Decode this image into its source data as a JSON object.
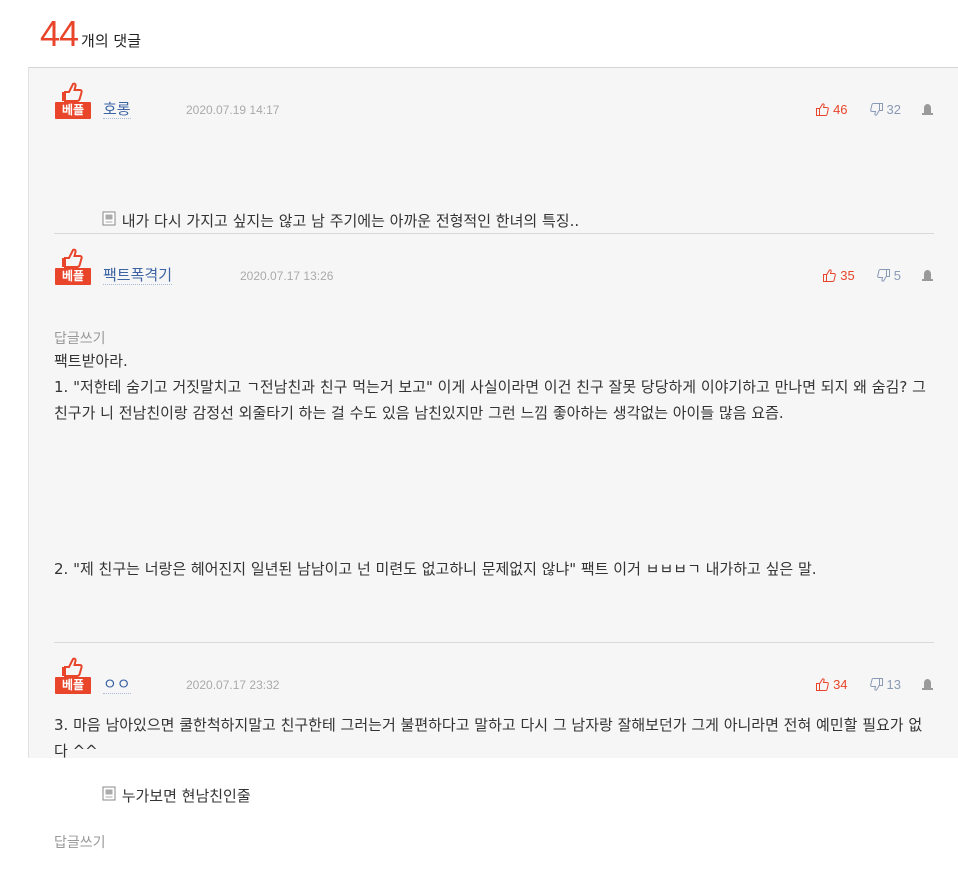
{
  "header": {
    "count": "44",
    "label": "개의 댓글"
  },
  "badge_label": "베플",
  "reply_label": "답글쓰기",
  "colors": {
    "accent": "#e8452b",
    "nick": "#3c64a5",
    "down": "#8a9ab5"
  },
  "comments": [
    {
      "nick": "호롱",
      "date": "2020.07.19 14:17",
      "up": "46",
      "down": "32",
      "text": "내가 다시 가지고 싶지는 않고 남 주기에는 아까운 전형적인 한녀의 특징.."
    },
    {
      "nick": "팩트폭격기",
      "date": "2020.07.17 13:26",
      "up": "35",
      "down": "5",
      "paragraphs": [
        "팩트받아라.\n1. \"저한테 숨기고 거짓말치고 ㄱ전남친과 친구 먹는거 보고\" 이게 사실이라면 이건 친구 잘못 당당하게 이야기하고 만나면 되지 왜 숨김? 그 친구가 니 전남친이랑 감정선 외줄타기 하는 걸 수도 있음 남친있지만 그런 느낌 좋아하는 생각없는 아이들 많음 요즘.",
        "",
        "2. \"제 친구는 너랑은 헤어진지 일년된 남남이고 넌 미련도 없고하니 문제없지 않냐\" 팩트 이거 ㅂㅂㅂㄱ 내가하고 싶은 말.",
        "",
        "3. 마음 남아있으면 쿨한척하지말고 친구한테 그러는거 불편하다고 말하고 다시 그 남자랑 잘해보던가 그게 아니라면 전혀 예민할 필요가 없다 ^^"
      ]
    },
    {
      "nick": "ㅇㅇ",
      "date": "2020.07.17 23:32",
      "up": "34",
      "down": "13",
      "text": "누가보면 현남친인줄"
    }
  ]
}
